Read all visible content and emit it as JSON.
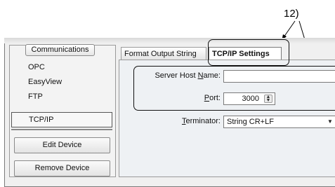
{
  "callout": {
    "label": "12)"
  },
  "sidebar": {
    "header": "Communications",
    "items": [
      {
        "label": "OPC",
        "selected": false
      },
      {
        "label": "EasyView",
        "selected": false
      },
      {
        "label": "FTP",
        "selected": false
      },
      {
        "label": "TCP/IP",
        "selected": true
      }
    ],
    "buttons": {
      "edit": "Edit Device",
      "remove": "Remove Device"
    }
  },
  "tabs": [
    {
      "label": "Format Output String",
      "active": false
    },
    {
      "label": "TCP/IP Settings",
      "active": true
    }
  ],
  "settings": {
    "server_host": {
      "label_pre": "Server Host ",
      "label_acc": "N",
      "label_post": "ame:",
      "value": ""
    },
    "port": {
      "label_pre": "",
      "label_acc": "P",
      "label_post": "ort:",
      "value": "3000"
    },
    "terminator": {
      "label_pre": "",
      "label_acc": "T",
      "label_post": "erminator:",
      "value": "String CR+LF"
    }
  }
}
